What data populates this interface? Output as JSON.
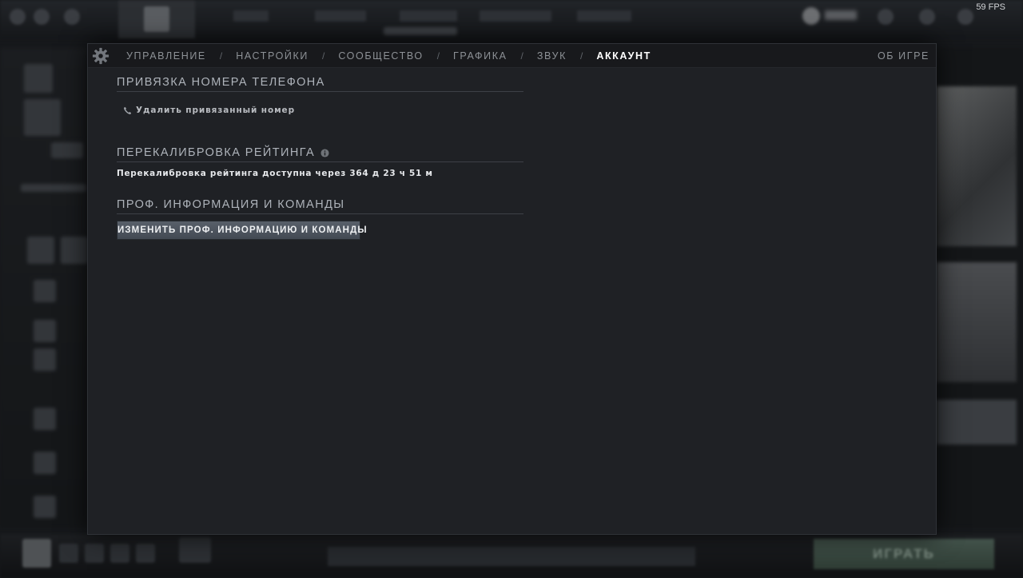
{
  "fps": "59 FPS",
  "tabs": [
    {
      "label": "УПРАВЛЕНИЕ"
    },
    {
      "label": "НАСТРОЙКИ"
    },
    {
      "label": "СООБЩЕСТВО"
    },
    {
      "label": "ГРАФИКА"
    },
    {
      "label": "ЗВУК"
    },
    {
      "label": "АККАУНТ",
      "active": true
    }
  ],
  "tab_separator": "/",
  "about_game": "ОБ ИГРЕ",
  "icons": {
    "settings": "gear-icon",
    "phone": "phone-icon",
    "info": "info-icon"
  },
  "sections": {
    "phone": {
      "title": "ПРИВЯЗКА НОМЕРА ТЕЛЕФОНА",
      "remove_label": "Удалить привязанный номер"
    },
    "recalibration": {
      "title": "ПЕРЕКАЛИБРОВКА РЕЙТИНГА",
      "status_text": "Перекалибровка рейтинга доступна через 364 д 23 ч 51 м"
    },
    "pro_info": {
      "title": "ПРОФ. ИНФОРМАЦИЯ И КОМАНДЫ",
      "button_label": "ИЗМЕНИТЬ ПРОФ. ИНФОРМАЦИЮ И КОМАНДЫ"
    }
  },
  "background": {
    "play_button": "ИГРАТЬ"
  },
  "colors": {
    "modal_bg": "#1f2125",
    "header_bg": "#18191c",
    "active_tab": "#ffffff",
    "inactive_tab": "#8d9196",
    "button_bg": "#4e555e"
  }
}
